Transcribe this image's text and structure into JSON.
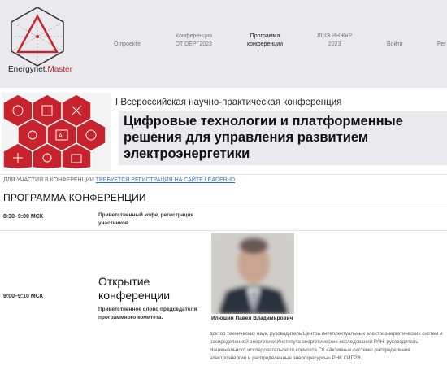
{
  "header": {
    "logo_text_main": "Energynet.",
    "logo_text_accent": "Master",
    "nav": [
      {
        "label": "О проекте"
      },
      {
        "label": "Конференция\nDT DEPГ2023"
      },
      {
        "label": "Программа\nконференции"
      },
      {
        "label": "ЛШЭ ИНЖиР\n2023"
      },
      {
        "label": "Войти"
      },
      {
        "label": "Рег"
      }
    ]
  },
  "banner": {
    "subtitle": "I Всероссийская научно-практическая конференция",
    "title": "Цифровые технологии и платформенные решения для управления развитием электроэнергетики"
  },
  "registration": {
    "prefix": "ДЛЯ УЧАСТИЯ В КОНФЕРЕНЦИИ ",
    "link": "ТРЕБУЕТСЯ РЕГИСТРАЦИЯ НА САЙТЕ LEADER-ID"
  },
  "program": {
    "heading": "ПРОГРАММА КОНФЕРЕНЦИИ",
    "events": [
      {
        "time": "8:30–9:00 МСК",
        "description": "Приветственный кофе, регистрация участников"
      },
      {
        "time": "9:00–9:10 МСК",
        "title": "Открытие конференции",
        "description": "Приветственное слово председателя программного комитета.",
        "speaker": {
          "name": "Илюшин Павел Владимирович",
          "bio": "доктор технических наук, руководитель Центра интеллектуальных электроэнергетических систем и распределенной энергетики Института энергетических исследований РАН, руководитель Национального исследовательского комитета С6 «Активные системы распределения электроэнергии и распределенные энергоресурсы» РНК СИГРЭ."
        }
      }
    ]
  },
  "colors": {
    "brand_red": "#c8232c",
    "header_bg": "#e9e9ee",
    "link_blue": "#2a73c9"
  }
}
